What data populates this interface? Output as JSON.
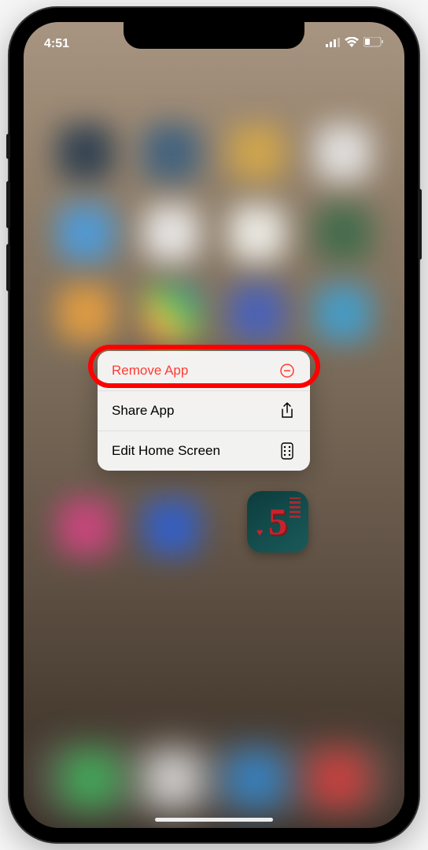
{
  "status": {
    "time": "4:51"
  },
  "menu": {
    "remove": {
      "label": "Remove App",
      "icon": "minus-circle"
    },
    "share": {
      "label": "Share App",
      "icon": "share"
    },
    "edit": {
      "label": "Edit Home Screen",
      "icon": "apps"
    }
  },
  "colors": {
    "danger": "#ff3b30",
    "highlight": "#ff0000"
  },
  "blurred_icons": {
    "row1": [
      "#2a3d4f",
      "#3a5f7f",
      "#d4a84a",
      "#e8e8e8"
    ],
    "row2": [
      "#4a9de0",
      "#f0f0f0",
      "#f5f5f0",
      "#3d6b4a"
    ],
    "row3": [
      "#e8a040",
      "#f5d040",
      "#4560c0",
      "#40a0d0"
    ],
    "row6": [
      "#d04580",
      "#3060d0",
      "#1a5a5a",
      "transparent"
    ],
    "dock": [
      "#40c060",
      "#f0f0f0",
      "#3090e0",
      "#e84040"
    ]
  }
}
